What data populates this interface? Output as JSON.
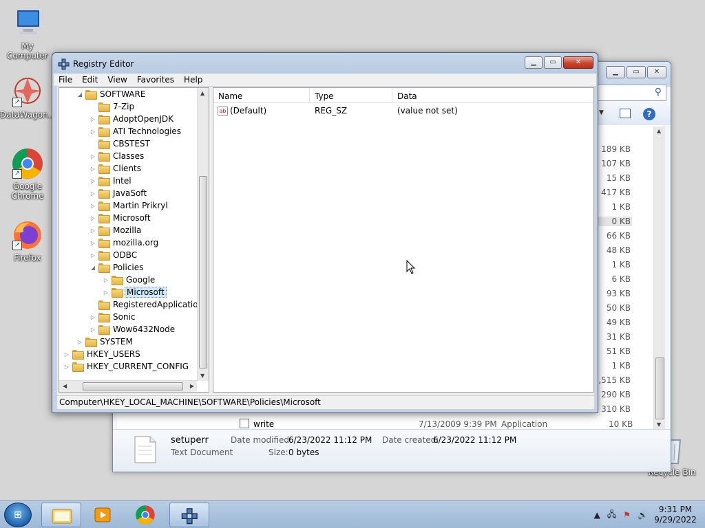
{
  "desktop": {
    "icons": [
      {
        "label": "My Computer"
      },
      {
        "label": "DataWagon..."
      },
      {
        "label": "Google Chrome"
      },
      {
        "label": "Firefox"
      },
      {
        "label": "Recycle Bin"
      }
    ]
  },
  "explorer": {
    "sizes": [
      "189 KB",
      "107 KB",
      "15 KB",
      "417 KB",
      "1 KB",
      "0 KB",
      "66 KB",
      "48 KB",
      "1 KB",
      "6 KB",
      "93 KB",
      "50 KB",
      "49 KB",
      "31 KB",
      "51 KB",
      "1 KB",
      "1,515 KB",
      "290 KB",
      "310 KB"
    ],
    "write_row": {
      "name": "write",
      "date": "7/13/2009 9:39 PM",
      "type": "Application",
      "size": "10 KB"
    },
    "details": {
      "name": "setuperr",
      "type": "Text Document",
      "date_modified_label": "Date modified:",
      "date_modified": "6/23/2022 11:12 PM",
      "date_created_label": "Date created:",
      "date_created": "6/23/2022 11:12 PM",
      "size_label": "Size:",
      "size": "0 bytes"
    }
  },
  "regedit": {
    "title": "Registry Editor",
    "menu": [
      "File",
      "Edit",
      "View",
      "Favorites",
      "Help"
    ],
    "tree": [
      {
        "label": "SOFTWARE",
        "level": 1,
        "expander": "open"
      },
      {
        "label": "7-Zip",
        "level": 2,
        "expander": "none"
      },
      {
        "label": "AdoptOpenJDK",
        "level": 2,
        "expander": "closed"
      },
      {
        "label": "ATI Technologies",
        "level": 2,
        "expander": "closed"
      },
      {
        "label": "CBSTEST",
        "level": 2,
        "expander": "none"
      },
      {
        "label": "Classes",
        "level": 2,
        "expander": "closed"
      },
      {
        "label": "Clients",
        "level": 2,
        "expander": "closed"
      },
      {
        "label": "Intel",
        "level": 2,
        "expander": "closed"
      },
      {
        "label": "JavaSoft",
        "level": 2,
        "expander": "closed"
      },
      {
        "label": "Martin Prikryl",
        "level": 2,
        "expander": "closed"
      },
      {
        "label": "Microsoft",
        "level": 2,
        "expander": "closed"
      },
      {
        "label": "Mozilla",
        "level": 2,
        "expander": "closed"
      },
      {
        "label": "mozilla.org",
        "level": 2,
        "expander": "closed"
      },
      {
        "label": "ODBC",
        "level": 2,
        "expander": "closed"
      },
      {
        "label": "Policies",
        "level": 2,
        "expander": "open"
      },
      {
        "label": "Google",
        "level": 3,
        "expander": "closed"
      },
      {
        "label": "Microsoft",
        "level": 3,
        "expander": "closed",
        "selected": true
      },
      {
        "label": "RegisteredApplications",
        "level": 2,
        "expander": "none"
      },
      {
        "label": "Sonic",
        "level": 2,
        "expander": "closed"
      },
      {
        "label": "Wow6432Node",
        "level": 2,
        "expander": "closed"
      },
      {
        "label": "SYSTEM",
        "level": 1,
        "expander": "closed"
      },
      {
        "label": "HKEY_USERS",
        "level": 0,
        "expander": "closed"
      },
      {
        "label": "HKEY_CURRENT_CONFIG",
        "level": 0,
        "expander": "closed"
      }
    ],
    "columns": {
      "name": "Name",
      "type": "Type",
      "data": "Data"
    },
    "values": [
      {
        "name": "(Default)",
        "type": "REG_SZ",
        "data": "(value not set)"
      }
    ],
    "status_path": "Computer\\HKEY_LOCAL_MACHINE\\SOFTWARE\\Policies\\Microsoft"
  },
  "taskbar": {
    "time": "9:31 PM",
    "date": "9/29/2022"
  }
}
